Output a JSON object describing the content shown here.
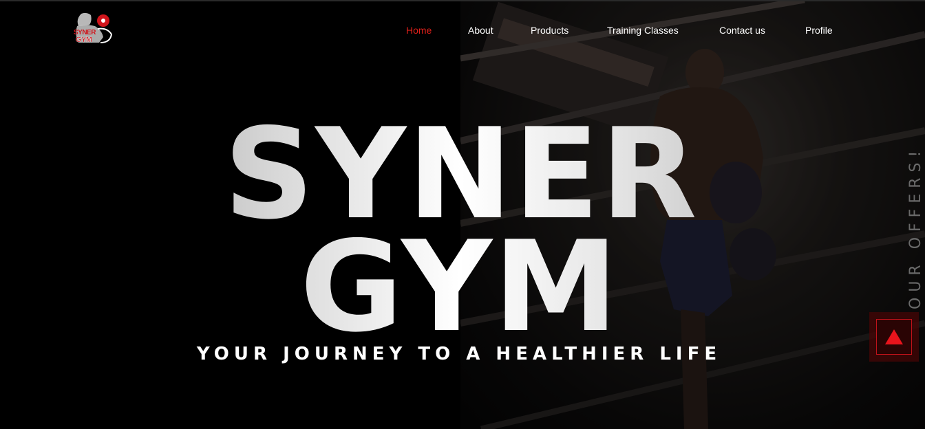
{
  "brand": {
    "logo_line1": "SYNER",
    "logo_line2": "GYM",
    "accent_color": "#e0201a"
  },
  "nav": {
    "items": [
      {
        "label": "Home",
        "active": true
      },
      {
        "label": "About",
        "active": false
      },
      {
        "label": "Products",
        "active": false
      },
      {
        "label": "Training Classes",
        "active": false
      },
      {
        "label": "Contact us",
        "active": false
      },
      {
        "label": "Profile",
        "active": false
      }
    ]
  },
  "hero": {
    "title_line1": "SYNER",
    "title_line2": "GYM",
    "tagline": "YOUR JOURNEY TO A HEALTHIER LIFE"
  },
  "side_label": "OUR OFFERS!",
  "icons": {
    "scroll_top": "triangle-up-icon",
    "logo": "dumbbell-flex-icon"
  }
}
